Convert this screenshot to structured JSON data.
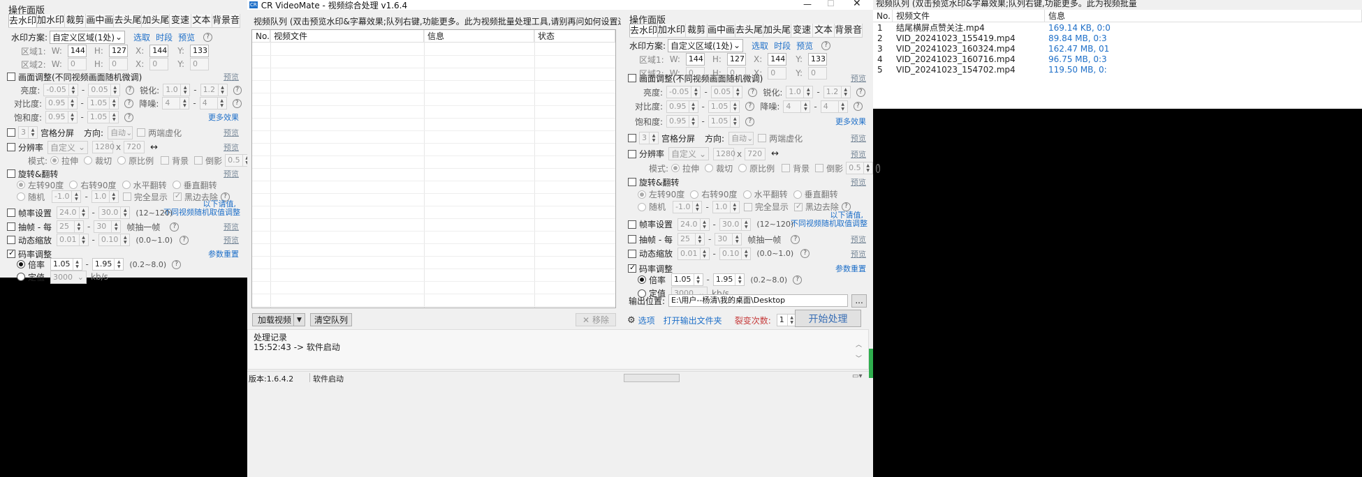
{
  "left_panel": {
    "title": "操作面版",
    "tabs": [
      "去水印",
      "加水印",
      "裁剪",
      "画中画",
      "去头尾",
      "加头尾",
      "变速",
      "文本",
      "背景音"
    ],
    "watermark_scheme_label": "水印方案:",
    "watermark_scheme_value": "自定义区域(1处)",
    "pick_link": "选取",
    "timeslot_link": "时段",
    "preview_link": "预览",
    "region1_label": "区域1:",
    "region2_label": "区域2:",
    "w_label": "W:",
    "h_label": "H:",
    "x_label": "X:",
    "y_label": "Y:",
    "r1_w": "144",
    "r1_h": "127",
    "r1_x": "144",
    "r1_y": "133",
    "r2_w": "0",
    "r2_h": "0",
    "r2_x": "0",
    "r2_y": "0",
    "picture_adjust": "画面调整(不同视频画面随机微调)",
    "preview_small": "预览",
    "brightness": "亮度:",
    "b_min": "-0.05",
    "b_max": "0.05",
    "sharpen": "锐化:",
    "s_min": "1.0",
    "s_max": "1.2",
    "contrast": "对比度:",
    "c_min": "0.95",
    "c_max": "1.05",
    "denoise": "降噪:",
    "d_min": "4",
    "d_max": "4",
    "saturation": "饱和度:",
    "sa_min": "0.95",
    "sa_max": "1.05",
    "more_effects": "更多效果",
    "grid_count": "3",
    "grid_split": "宫格分屏",
    "direction": "方向:",
    "direction_value": "自动",
    "blur_edges": "两端虚化",
    "resolution": "分辨率",
    "resolution_value": "自定义",
    "res_w": "1280",
    "res_x": "x",
    "res_h": "720",
    "swap_icon": "↔",
    "mode": "模式:",
    "stretch": "拉伸",
    "crop": "裁切",
    "original": "原比例",
    "background": "背景",
    "reflection": "倒影",
    "refl_val": "0.5",
    "rotate_flip": "旋转&翻转",
    "rot_left": "左转90度",
    "rot_right": "右转90度",
    "flip_h": "水平翻转",
    "flip_v": "垂直翻转",
    "random": "随机",
    "rand_min": "-1.0",
    "rand_max": "1.0",
    "full_show": "完全显示",
    "black_remove": "黑边去除",
    "random_note1": "以下请值,",
    "random_note2": "不同视频随机取值调整",
    "fps_setting": "帧率设置",
    "fps_min": "24.0",
    "fps_max": "30.0",
    "fps_range": "(12~120)",
    "frame_drop": "抽帧 - 每",
    "fd_min": "25",
    "fd_max": "30",
    "fd_unit": "帧抽一帧",
    "dyn_zoom": "动态缩放",
    "dz_min": "0.01",
    "dz_max": "0.10",
    "dz_range": "(0.0~1.0)",
    "bitrate": "码率调整",
    "reset_params": "参数重置",
    "multiplier": "倍率",
    "m_min": "1.05",
    "m_max": "1.95",
    "m_range": "(0.2~8.0)",
    "fixed": "定值",
    "fixed_value": "3000",
    "kbs": "kb/s",
    "dash": "-"
  },
  "main_window": {
    "icon": "CR",
    "title": "CR VideoMate - 视频综合处理 v1.6.4",
    "queue_label": "视频队列 (双击预览水印&字幕效果;队列右键,功能更多。此为视频批量处理工具,请别再问如何设置过审,谢~)",
    "columns": [
      "No.",
      "视频文件",
      "信息",
      "状态"
    ],
    "load_video": "加载视频",
    "clear_queue": "清空队列",
    "remove": "移除",
    "log_label": "处理记录",
    "log_line": "15:52:43 -> 软件启动",
    "version": "版本:1.6.4.2",
    "status": "软件启动",
    "output_label": "输出位置:",
    "output_path": "E:\\用户--杨清\\我的桌面\\Desktop",
    "browse": "...",
    "options": "选项",
    "open_folder": "打开输出文件夹",
    "fission": "裂变次数:",
    "fission_value": "1",
    "start": "开始处理"
  },
  "right_list": {
    "header_label": "视频队列 (双击预览水印&字幕效果;队列右键,功能更多。此为视频批量",
    "columns": [
      "No.",
      "视频文件",
      "信息"
    ],
    "rows": [
      {
        "no": "1",
        "file": "结尾横屏点赞关注.mp4",
        "info": "169.14 KB, 0:0"
      },
      {
        "no": "2",
        "file": "VID_20241023_155419.mp4",
        "info": "89.84 MB, 0:3"
      },
      {
        "no": "3",
        "file": "VID_20241023_160324.mp4",
        "info": "162.47 MB, 01"
      },
      {
        "no": "4",
        "file": "VID_20241023_160716.mp4",
        "info": "96.75 MB, 0:3"
      },
      {
        "no": "5",
        "file": "VID_20241023_154702.mp4",
        "info": "119.50 MB, 0:"
      }
    ]
  }
}
